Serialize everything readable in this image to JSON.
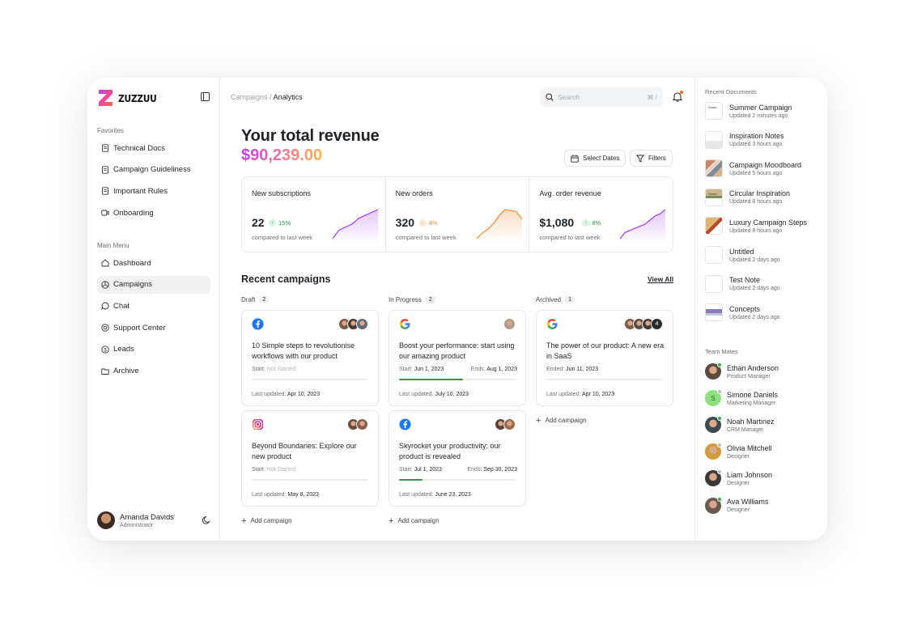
{
  "brand": {
    "name": "ZUZZUU"
  },
  "sidebar": {
    "favorites_label": "Favorites",
    "favorites": [
      {
        "label": "Technical Docs",
        "icon": "document-icon"
      },
      {
        "label": "Campaign Guideliness",
        "icon": "document-icon"
      },
      {
        "label": "Important Rules",
        "icon": "document-icon"
      },
      {
        "label": "Onboarding",
        "icon": "video-icon"
      }
    ],
    "menu_label": "Main Menu",
    "menu": [
      {
        "label": "Dashboard",
        "icon": "home-icon"
      },
      {
        "label": "Campaigns",
        "icon": "campaign-icon",
        "active": true
      },
      {
        "label": "Chat",
        "icon": "chat-icon"
      },
      {
        "label": "Support Center",
        "icon": "support-icon"
      },
      {
        "label": "Leads",
        "icon": "dollar-icon"
      },
      {
        "label": "Archive",
        "icon": "folder-icon"
      }
    ],
    "user": {
      "name": "Amanda Davids",
      "role": "Administrator"
    }
  },
  "header": {
    "breadcrumb_parent": "Campaigns",
    "breadcrumb_sep": "/",
    "breadcrumb_current": "Analytics",
    "search_placeholder": "Search",
    "search_shortcut": "⌘ /"
  },
  "revenue": {
    "title": "Your total revenue",
    "amount": "$90,239.00",
    "select_dates_label": "Select Dates",
    "filters_label": "Filters"
  },
  "stats": [
    {
      "title": "New subscriptions",
      "value": "22",
      "delta": "15%",
      "direction": "up",
      "sub": "compared to last week",
      "color": "#a23bf0",
      "spark": [
        20,
        14,
        12,
        10,
        6,
        4,
        2,
        0
      ]
    },
    {
      "title": "New orders",
      "value": "320",
      "delta": "4%",
      "direction": "down",
      "sub": "compared to last week",
      "color": "#f28a2b",
      "spark": [
        30,
        24,
        20,
        14,
        6,
        0,
        1,
        2,
        10
      ]
    },
    {
      "title": "Avg. order revenue",
      "value": "$1,080",
      "delta": "8%",
      "direction": "up",
      "sub": "compared to last week",
      "color": "#a23bf0",
      "spark": [
        28,
        22,
        20,
        18,
        16,
        14,
        10,
        6,
        4,
        0
      ]
    }
  ],
  "campaigns": {
    "title": "Recent campaigns",
    "view_all": "View All",
    "add_label": "Add campaign",
    "columns": [
      {
        "label": "Draft",
        "count": "2",
        "cards": [
          {
            "platform": "facebook",
            "title": "10 Simple steps to revolutionise workflows with our product",
            "start_label": "Start:",
            "start": "Not Started",
            "end_label": "",
            "end": "",
            "progress": 0,
            "updated_label": "Last updated:",
            "updated": "Apr 10, 2023",
            "avatars": [
              "#7b5a4a",
              "#4a3a34",
              "#5b6d7a"
            ]
          },
          {
            "platform": "instagram",
            "title": "Beyond Boundaries: Explore our new product",
            "start_label": "Start:",
            "start": "Not Started",
            "end_label": "",
            "end": "",
            "progress": 0,
            "updated_label": "Last updated:",
            "updated": "May 8, 2023",
            "avatars": [
              "#6b4a3a",
              "#8a5a4a"
            ]
          }
        ]
      },
      {
        "label": "In Progress",
        "count": "2",
        "cards": [
          {
            "platform": "google",
            "title": "Boost your performance: start using our amazing product",
            "start_label": "Start:",
            "start": "Jun 1, 2023",
            "end_label": "Ends:",
            "end": "Aug 1, 2023",
            "progress": 0.55,
            "updated_label": "Last updated:",
            "updated": "July 10, 2023",
            "avatars": [
              "#b49a88"
            ]
          },
          {
            "platform": "facebook",
            "title": "Skyrocket your productivity: our product is revealed",
            "start_label": "Start:",
            "start": "Jul 1, 2023",
            "end_label": "Ends:",
            "end": "Sep 30, 2023",
            "progress": 0.2,
            "updated_label": "Last updated:",
            "updated": "June 23, 2023",
            "avatars": [
              "#5a4034",
              "#a06a4a"
            ]
          }
        ]
      },
      {
        "label": "Archived",
        "count": "1",
        "cards": [
          {
            "platform": "google",
            "title": "The power of our product: A new era in SaaS",
            "start_label": "Ended:",
            "start": "Jun 11, 2023",
            "end_label": "",
            "end": "",
            "progress": 0,
            "updated_label": "Last updated:",
            "updated": "Apr 10, 2023",
            "avatars": [
              "#7b5a4a",
              "#5b4a40",
              "#3e3a36"
            ],
            "extra_count": "4"
          }
        ]
      }
    ]
  },
  "documents": {
    "label": "Recent Documents",
    "items": [
      {
        "title": "Summer Campaign",
        "updated": "Updated 2 minutes ago",
        "thumb_text": "Some"
      },
      {
        "title": "Inspiration Notes",
        "updated": "Updated 3 hours ago"
      },
      {
        "title": "Campaign Moodboard",
        "updated": "Updated 5 hours ago"
      },
      {
        "title": "Circular Inspiration",
        "updated": "Updated 8 hours ago",
        "thumb_text": "Some"
      },
      {
        "title": "Luxury Campaign Steps",
        "updated": "Updated 8 hours ago"
      },
      {
        "title": "Untitled",
        "updated": "Updated 2 days ago"
      },
      {
        "title": "Test Note",
        "updated": "Updated 2 days ago"
      },
      {
        "title": "Concepts",
        "updated": "Updated 2 days ago"
      }
    ]
  },
  "team": {
    "label": "Team Mates",
    "members": [
      {
        "name": "Ethan Anderson",
        "role": "Product Manager",
        "avatar_color": "#5a4a40",
        "status": "#2cb34a"
      },
      {
        "name": "Simone Daniels",
        "role": "Marketing Manager",
        "avatar_color": "#8fe07f",
        "initial": "S",
        "status": "#b9bcc0"
      },
      {
        "name": "Noah Martinez",
        "role": "CRM Manager",
        "avatar_color": "#3e4a50",
        "status": "#2cb34a"
      },
      {
        "name": "Olivia Mitchell",
        "role": "Designer",
        "avatar_color": "#d49a3a",
        "status": "#b9bcc0"
      },
      {
        "name": "Liam Johnson",
        "role": "Designer",
        "avatar_color": "#3a3a3a",
        "status": "#b9bcc0"
      },
      {
        "name": "Ava Williams",
        "role": "Designer",
        "avatar_color": "#6b5a50",
        "status": "#2cb34a"
      }
    ]
  }
}
